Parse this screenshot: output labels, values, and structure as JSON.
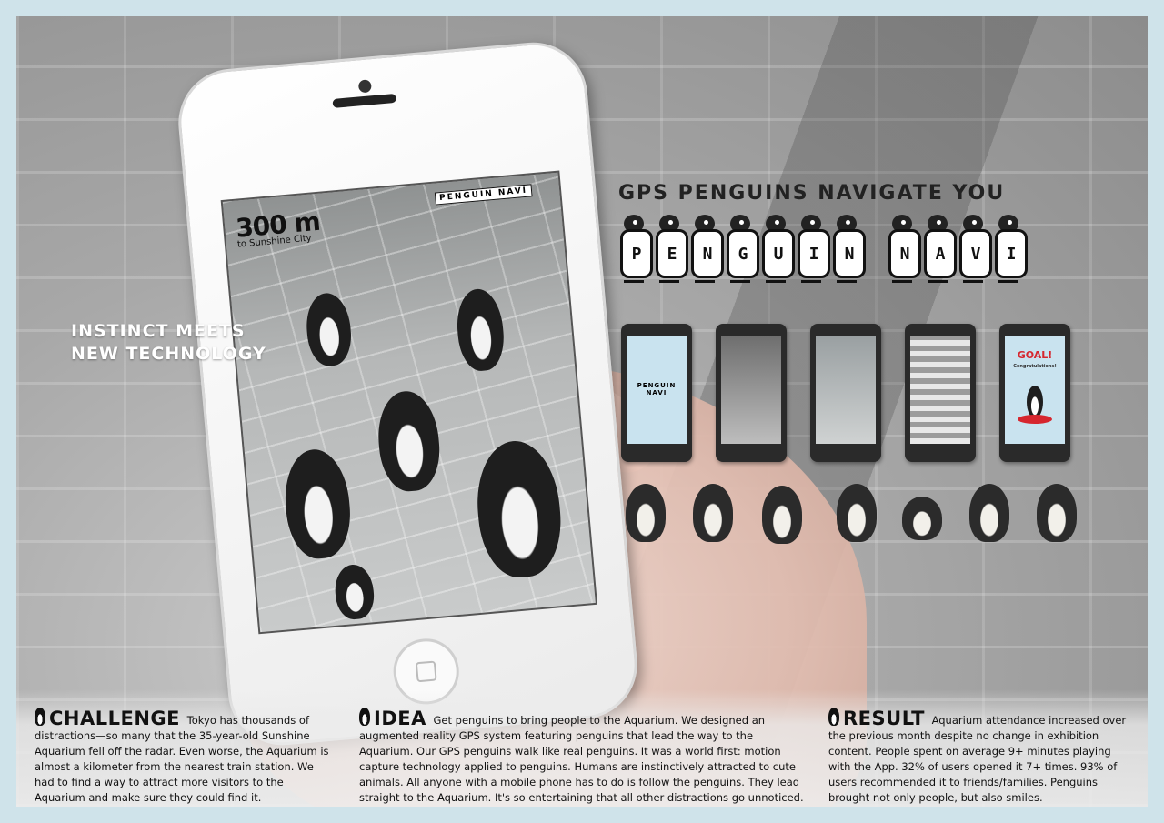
{
  "phone": {
    "distance": "300 m",
    "destination": "to Sunshine City",
    "mini_logo": "PENGUIN NAVI"
  },
  "headline": "GPS PENGUINS NAVIGATE YOU",
  "logo_letters": [
    "P",
    "E",
    "N",
    "G",
    "U",
    "I",
    "N",
    "N",
    "A",
    "V",
    "I"
  ],
  "tagline_line1": "INSTINCT MEETS",
  "tagline_line2": "NEW TECHNOLOGY",
  "mini_phones": {
    "goal": "GOAL!",
    "congrats": "Congratulations!"
  },
  "challenge": {
    "heading": "CHALLENGE",
    "text": "Tokyo has thousands of distractions—so many that the 35-year-old Sunshine Aquarium fell off the radar. Even worse, the Aquarium is almost a kilometer from the nearest train station. We had to find a way to attract more visitors to the Aquarium and make sure they could find it."
  },
  "idea": {
    "heading": "IDEA",
    "text": "Get penguins to bring people to the Aquarium. We designed an augmented reality GPS system featuring penguins that lead the way to the Aquarium. Our GPS penguins walk like real penguins. It was a world first: motion capture technology applied to penguins. Humans are instinctively attracted to cute animals. All anyone with a mobile phone has to do is follow the penguins. They lead straight to the Aquarium. It's so entertaining that all other distractions go unnoticed."
  },
  "result": {
    "heading": "RESULT",
    "text": "Aquarium attendance increased over the previous month despite no change in exhibition content. People spent on average 9+ minutes playing with the App. 32% of users opened it 7+ times. 93% of users recommended it to friends/families. Penguins brought not only people, but also smiles."
  },
  "colors": {
    "frame": "#cfe3ea",
    "goal_red": "#d6262e",
    "screen_blue": "#c9e3ef"
  }
}
